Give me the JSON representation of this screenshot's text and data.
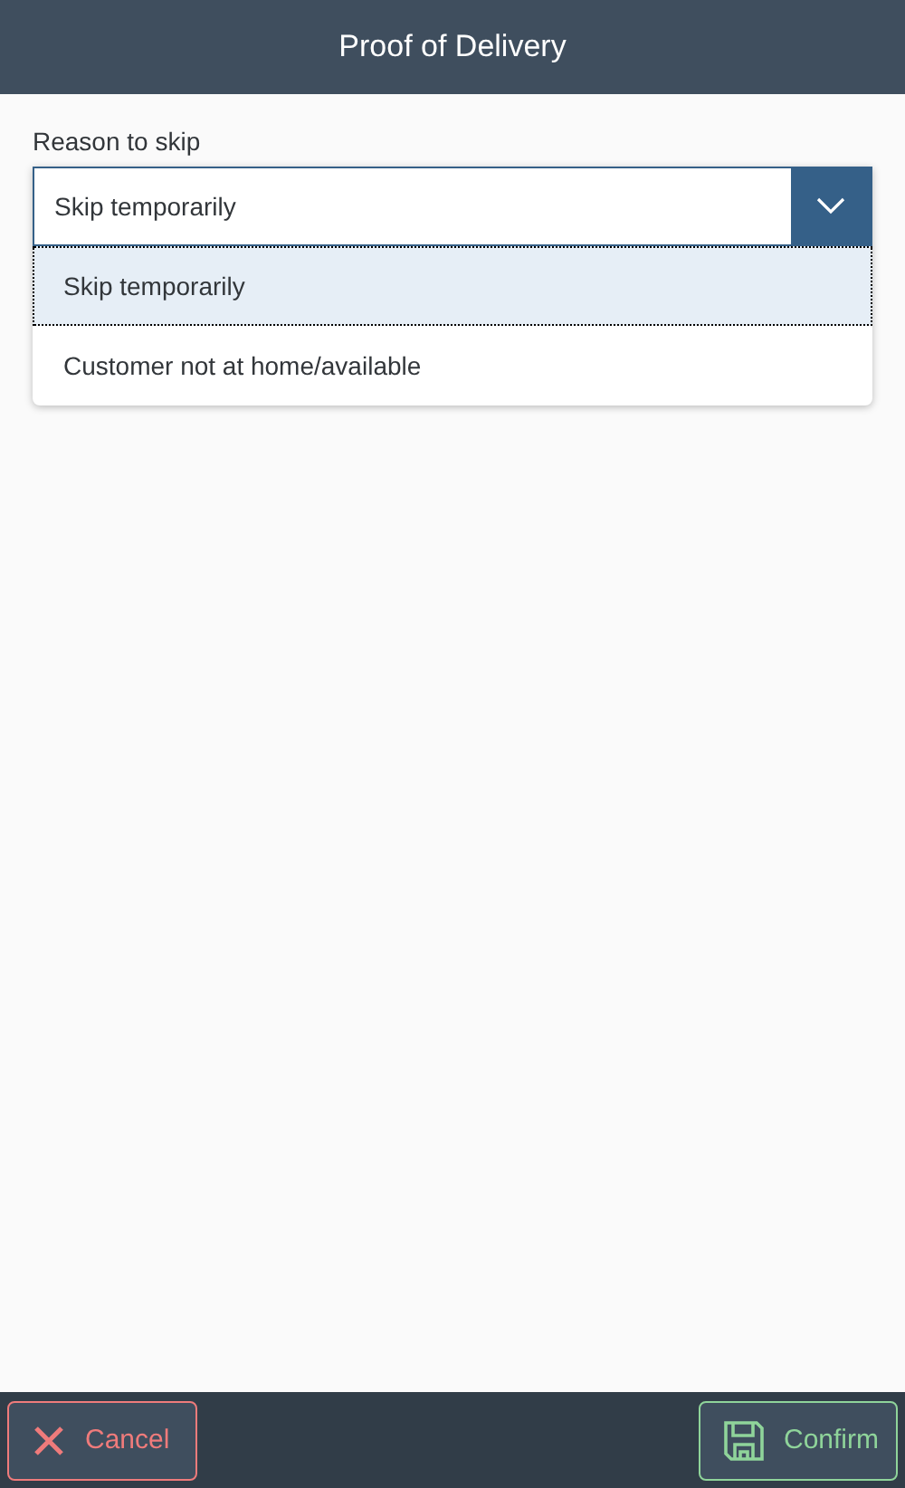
{
  "header": {
    "title": "Proof of Delivery"
  },
  "field": {
    "label": "Reason to skip",
    "value": "Skip temporarily",
    "expanded": true,
    "options": [
      {
        "label": "Skip temporarily",
        "selected": true
      },
      {
        "label": "Customer not at home/available",
        "selected": false
      }
    ]
  },
  "footer": {
    "buttons": [
      {
        "label": "Cancel",
        "kind": "reject"
      },
      {
        "label": "Confirm",
        "kind": "accept"
      }
    ]
  }
}
